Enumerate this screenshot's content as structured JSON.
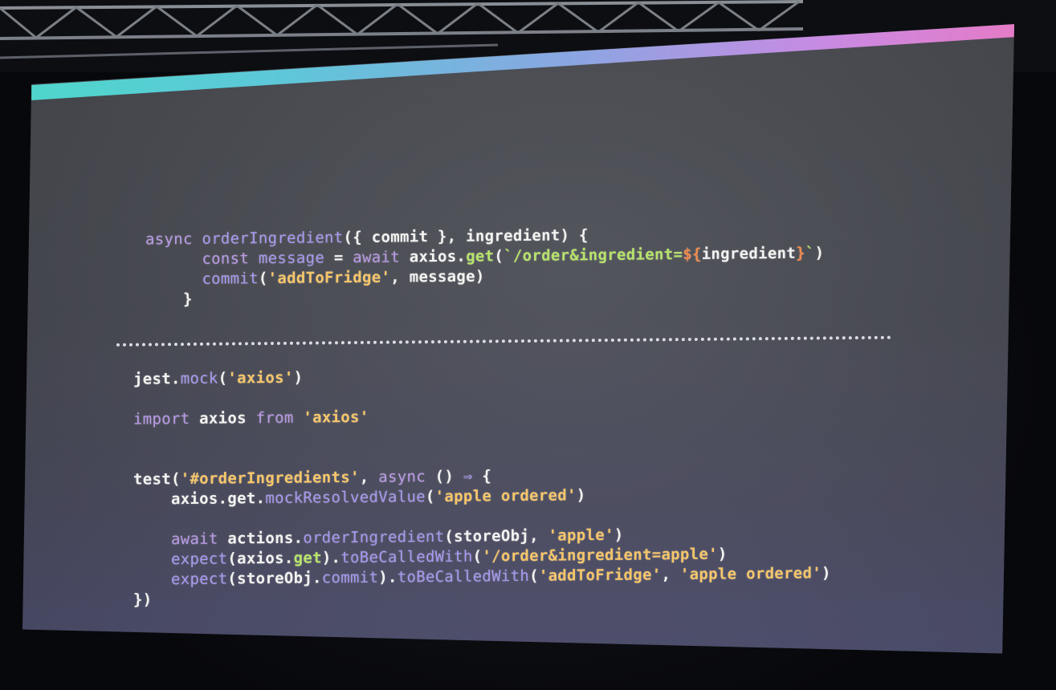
{
  "slide": {
    "colors": {
      "background": "#4c4e54",
      "accent_start": "#4fd6cb",
      "accent_end": "#e57bc7",
      "keyword": "#b99ae6",
      "string": "#f6c66a",
      "method": "#b7e36a",
      "template": "#f28a4c"
    },
    "top_code": [
      [
        {
          "text": "async",
          "style": "kw"
        },
        {
          "text": " ",
          "style": "plain"
        },
        {
          "text": "orderIngredient",
          "style": "fn"
        },
        {
          "text": "({ commit }, ingredient) {",
          "style": "plain"
        }
      ],
      [
        {
          "text": "      ",
          "style": "plain"
        },
        {
          "text": "const",
          "style": "kw"
        },
        {
          "text": " ",
          "style": "plain"
        },
        {
          "text": "message",
          "style": "fn"
        },
        {
          "text": " = ",
          "style": "plain"
        },
        {
          "text": "await",
          "style": "kw"
        },
        {
          "text": " axios.",
          "style": "plain"
        },
        {
          "text": "get",
          "style": "ok"
        },
        {
          "text": "(",
          "style": "plain"
        },
        {
          "text": "`/order&ingredient=",
          "style": "ok"
        },
        {
          "text": "${",
          "style": "tp"
        },
        {
          "text": "ingredient",
          "style": "plain"
        },
        {
          "text": "}",
          "style": "tp"
        },
        {
          "text": "`",
          "style": "ok"
        },
        {
          "text": ")",
          "style": "plain"
        }
      ],
      [
        {
          "text": "      ",
          "style": "plain"
        },
        {
          "text": "commit",
          "style": "fn"
        },
        {
          "text": "(",
          "style": "plain"
        },
        {
          "text": "'addToFridge'",
          "style": "str"
        },
        {
          "text": ", message)",
          "style": "plain"
        }
      ],
      [
        {
          "text": "    ",
          "style": "plain"
        },
        {
          "text": "}",
          "style": "plain"
        }
      ]
    ],
    "bottom_code": [
      [
        {
          "text": "jest.",
          "style": "plain"
        },
        {
          "text": "mock",
          "style": "fn"
        },
        {
          "text": "(",
          "style": "plain"
        },
        {
          "text": "'axios'",
          "style": "str"
        },
        {
          "text": ")",
          "style": "plain"
        }
      ],
      [],
      [
        {
          "text": "import",
          "style": "kw"
        },
        {
          "text": " axios ",
          "style": "plain"
        },
        {
          "text": "from",
          "style": "kw"
        },
        {
          "text": " ",
          "style": "plain"
        },
        {
          "text": "'axios'",
          "style": "str"
        }
      ],
      [],
      [],
      [
        {
          "text": "test(",
          "style": "plain"
        },
        {
          "text": "'#orderIngredients'",
          "style": "str"
        },
        {
          "text": ", ",
          "style": "plain"
        },
        {
          "text": "async",
          "style": "kw"
        },
        {
          "text": " () ",
          "style": "plain"
        },
        {
          "text": "⇒",
          "style": "fn"
        },
        {
          "text": " {",
          "style": "plain"
        }
      ],
      [
        {
          "text": "    axios.get.",
          "style": "plain"
        },
        {
          "text": "mockResolvedValue",
          "style": "fn"
        },
        {
          "text": "(",
          "style": "plain"
        },
        {
          "text": "'apple ordered'",
          "style": "str"
        },
        {
          "text": ")",
          "style": "plain"
        }
      ],
      [],
      [
        {
          "text": "    ",
          "style": "plain"
        },
        {
          "text": "await",
          "style": "kw"
        },
        {
          "text": " actions.",
          "style": "plain"
        },
        {
          "text": "orderIngredient",
          "style": "fn"
        },
        {
          "text": "(storeObj, ",
          "style": "plain"
        },
        {
          "text": "'apple'",
          "style": "str"
        },
        {
          "text": ")",
          "style": "plain"
        }
      ],
      [
        {
          "text": "    ",
          "style": "plain"
        },
        {
          "text": "expect",
          "style": "fn"
        },
        {
          "text": "(axios.",
          "style": "plain"
        },
        {
          "text": "get",
          "style": "ok"
        },
        {
          "text": ").",
          "style": "plain"
        },
        {
          "text": "toBeCalledWith",
          "style": "fn"
        },
        {
          "text": "(",
          "style": "plain"
        },
        {
          "text": "'/order&ingredient=apple'",
          "style": "str"
        },
        {
          "text": ")",
          "style": "plain"
        }
      ],
      [
        {
          "text": "    ",
          "style": "plain"
        },
        {
          "text": "expect",
          "style": "fn"
        },
        {
          "text": "(storeObj.",
          "style": "plain"
        },
        {
          "text": "commit",
          "style": "fn"
        },
        {
          "text": ").",
          "style": "plain"
        },
        {
          "text": "toBeCalledWith",
          "style": "fn"
        },
        {
          "text": "(",
          "style": "plain"
        },
        {
          "text": "'addToFridge'",
          "style": "str"
        },
        {
          "text": ", ",
          "style": "plain"
        },
        {
          "text": "'apple ordered'",
          "style": "str"
        },
        {
          "text": ")",
          "style": "plain"
        }
      ],
      [
        {
          "text": "})",
          "style": "plain"
        }
      ]
    ]
  }
}
